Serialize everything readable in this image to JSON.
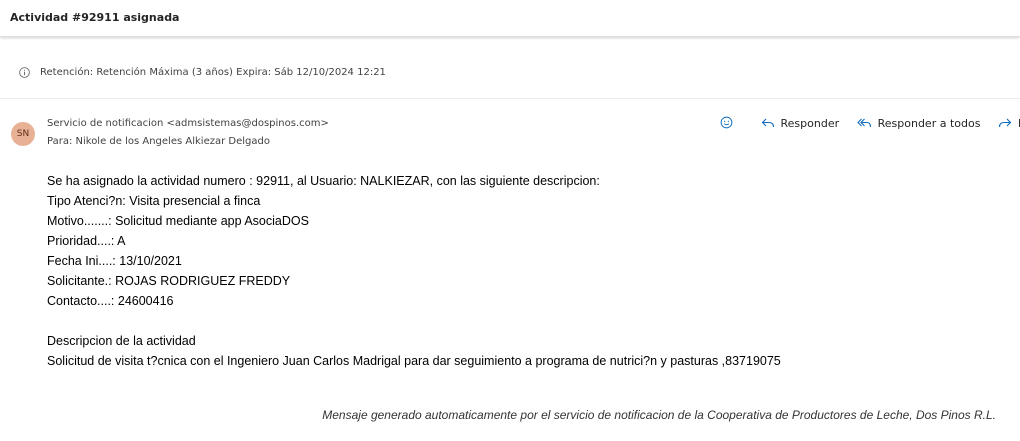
{
  "subject": "Actividad #92911 asignada",
  "retention": "Retención: Retención Máxima (3 años) Expira: Sáb 12/10/2024 12:21",
  "sender": {
    "initials": "SN",
    "from": "Servicio de notificacion <admsistemas@dospinos.com>",
    "to": "Para: Nikole de los Angeles Alkiezar Delgado"
  },
  "actions": {
    "reply": "Responder",
    "reply_all": "Responder a todos",
    "forward": "Re"
  },
  "body": {
    "line1": "Se ha asignado la actividad numero : 92911, al Usuario: NALKIEZAR, con las siguiente descripcion:",
    "line2": "Tipo Atenci?n: Visita presencial a finca",
    "line3": "Motivo.......: Solicitud mediante app AsociaDOS",
    "line4": "Prioridad....: A",
    "line5": "Fecha Ini....: 13/10/2021",
    "line6": "Solicitante.: ROJAS RODRIGUEZ FREDDY",
    "line7": "Contacto....: 24600416",
    "desc_title": "Descripcion de la actividad",
    "desc_text": "Solicitud de visita t?cnica con el Ingeniero Juan Carlos Madrigal para dar seguimiento a programa de nutrici?n y pasturas ,83719075"
  },
  "footer": "Mensaje generado automaticamente por el servicio de notificacion de la Cooperativa de Productores de Leche, Dos Pinos R.L.",
  "colors": {
    "accent": "#0f6cbd",
    "avatar_bg": "#e8b196"
  }
}
